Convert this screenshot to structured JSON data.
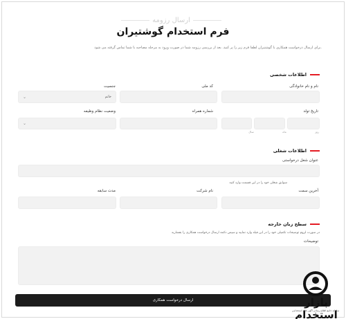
{
  "page": {
    "subtitle": "ارسال رزومه",
    "title": "فرم استخدام گوشتیران",
    "intro": "برای ارسال درخواست همکاری با گوشتیران لطفا فرم زیر را پر کنید. بعد از بررسی رزومه شما در صورت ورود به مرحله مصاحبه با شما تماس گرفته می شود."
  },
  "personal": {
    "heading": "اطلاعات شخصی",
    "full_name_label": "نام و نام خانوادگی",
    "national_code_label": "کد ملی",
    "gender_label": "جنسیت",
    "gender_value": "خانم",
    "birth_date_label": "تاریخ تولد",
    "day_label": "روز",
    "month_label": "ماه",
    "year_label": "سال",
    "phone_label": "شماره همراه",
    "military_label": "وضعیت نظام وظیفه"
  },
  "job": {
    "heading": "اطلاعات شغلی",
    "position_label": "عنوان شغل درخواستی",
    "history_hint": "سوابق شغلی خود را در این قسمت وارد کنید",
    "last_position_label": "آخرین سمت",
    "company_label": "نام شرکت",
    "duration_label": "مدت سابقه"
  },
  "language": {
    "heading": "سطح زبان خارجه",
    "hint": "در صورت لزوم توضیحات تکمیلی خود را در این فیلد وارد نمایید و سپس دکمه ارسال درخواست همکاری را بفشارید",
    "notes_label": "توضیحات"
  },
  "submit_label": "ارسال درخواست همکاری",
  "logo": {
    "text": "بازار استخدام",
    "sub": "سامانه جامع اطلاع رسانی آگهی های استخدامی"
  }
}
